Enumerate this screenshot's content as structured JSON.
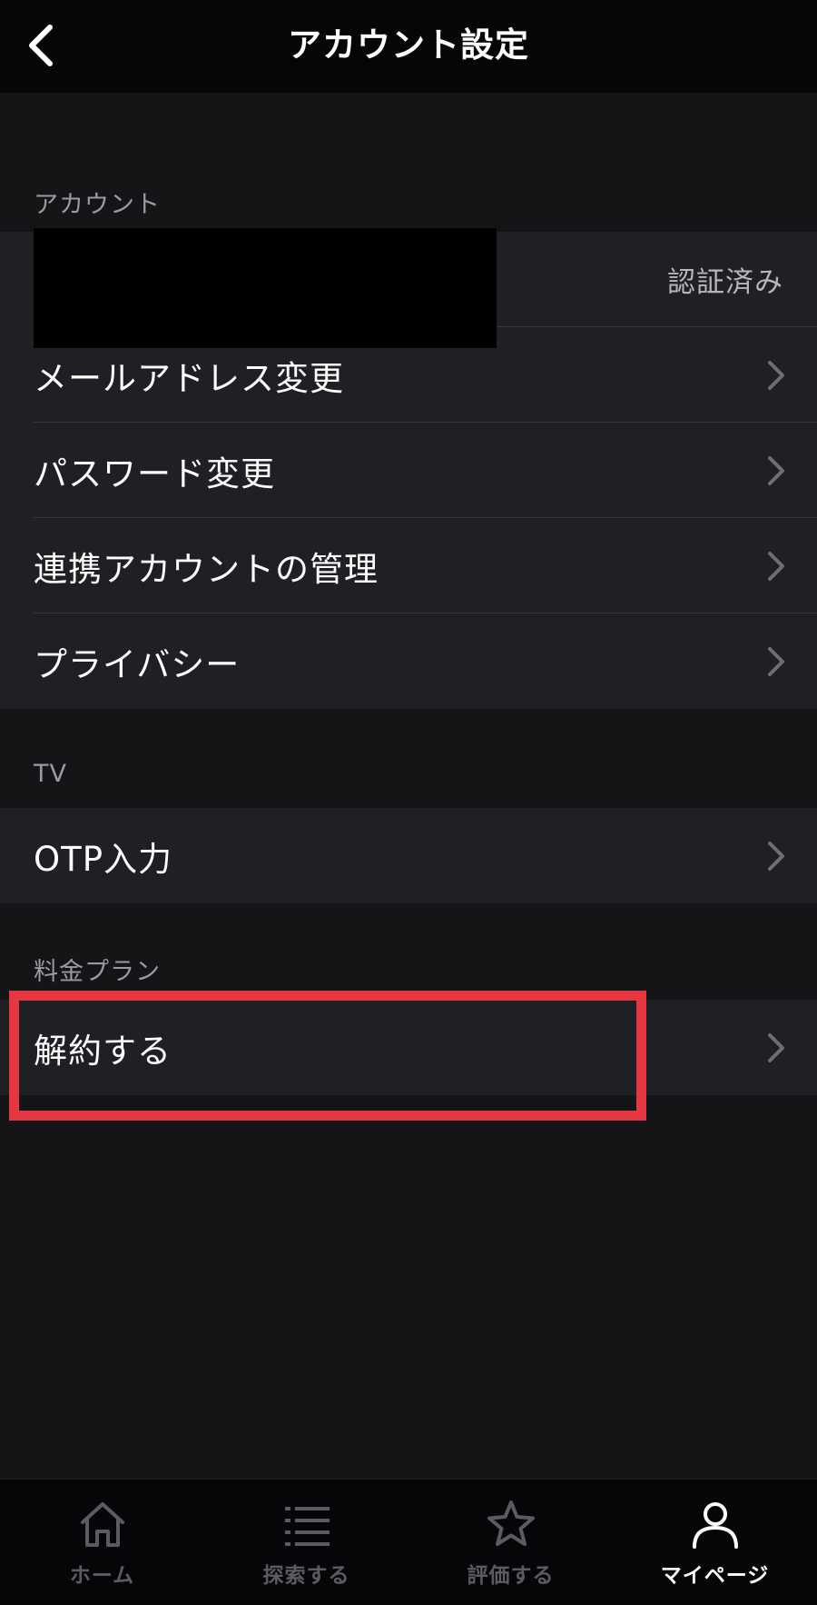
{
  "header": {
    "title": "アカウント設定"
  },
  "sections": {
    "account": {
      "title": "アカウント",
      "verified_status": "認証済み",
      "items": [
        "メールアドレス変更",
        "パスワード変更",
        "連携アカウントの管理",
        "プライバシー"
      ]
    },
    "tv": {
      "title": "TV",
      "items": [
        "OTP入力"
      ]
    },
    "plan": {
      "title": "料金プラン",
      "items": [
        "解約する"
      ]
    }
  },
  "tabbar": {
    "tabs": [
      {
        "label": "ホーム",
        "icon": "home-icon"
      },
      {
        "label": "探索する",
        "icon": "list-icon"
      },
      {
        "label": "評価する",
        "icon": "star-icon"
      },
      {
        "label": "マイページ",
        "icon": "person-icon"
      }
    ],
    "active_index": 3
  },
  "colors": {
    "background": "#141517",
    "row_background": "#1f2023",
    "bar_background": "#050607",
    "highlight": "#e53641"
  }
}
